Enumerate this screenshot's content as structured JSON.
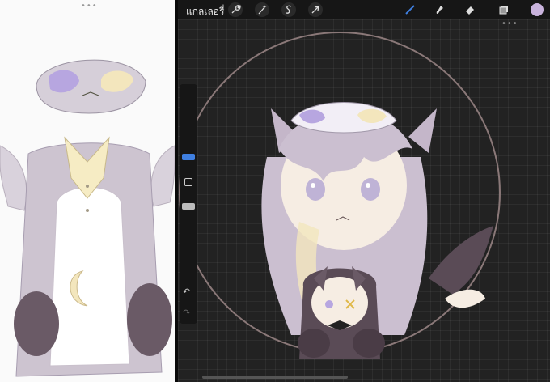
{
  "topbar": {
    "gallery_label": "แกลเลอรี่",
    "tools_left": [
      {
        "name": "actions",
        "icon": "wrench-icon"
      },
      {
        "name": "adjustments",
        "icon": "magic-wand-icon"
      },
      {
        "name": "selection",
        "icon": "selection-s-icon"
      },
      {
        "name": "transform",
        "icon": "arrow-cursor-icon"
      }
    ],
    "tools_right": [
      {
        "name": "brush",
        "icon": "brush-icon"
      },
      {
        "name": "smudge",
        "icon": "smudge-icon"
      },
      {
        "name": "eraser",
        "icon": "eraser-icon"
      },
      {
        "name": "layers",
        "icon": "layers-icon"
      },
      {
        "name": "color",
        "icon": "color-swatch-icon"
      }
    ],
    "active_tool": "brush",
    "current_color": "#c9b3dd",
    "active_tool_color": "#3f7fe0"
  },
  "sidebar": {
    "brush_size_color": "#3f7fe0",
    "opacity_color": "#bbbbbb",
    "undo_icon": "undo-icon",
    "redo_icon": "redo-icon"
  },
  "canvas": {
    "palette": {
      "hair": "#cbbfd0",
      "skin": "#f6ede3",
      "cream": "#f3e6bd",
      "dark_fur": "#5a4b56",
      "ring": "#8a7878",
      "background": "#222222"
    }
  },
  "reference": {
    "palette": {
      "body": "#cdc4d0",
      "belly": "#ffffff",
      "collar": "#f6ecc4",
      "paw": "#6a5a66",
      "moon": "#f3e6bd",
      "mask_eye": "#b7a6e0"
    }
  }
}
